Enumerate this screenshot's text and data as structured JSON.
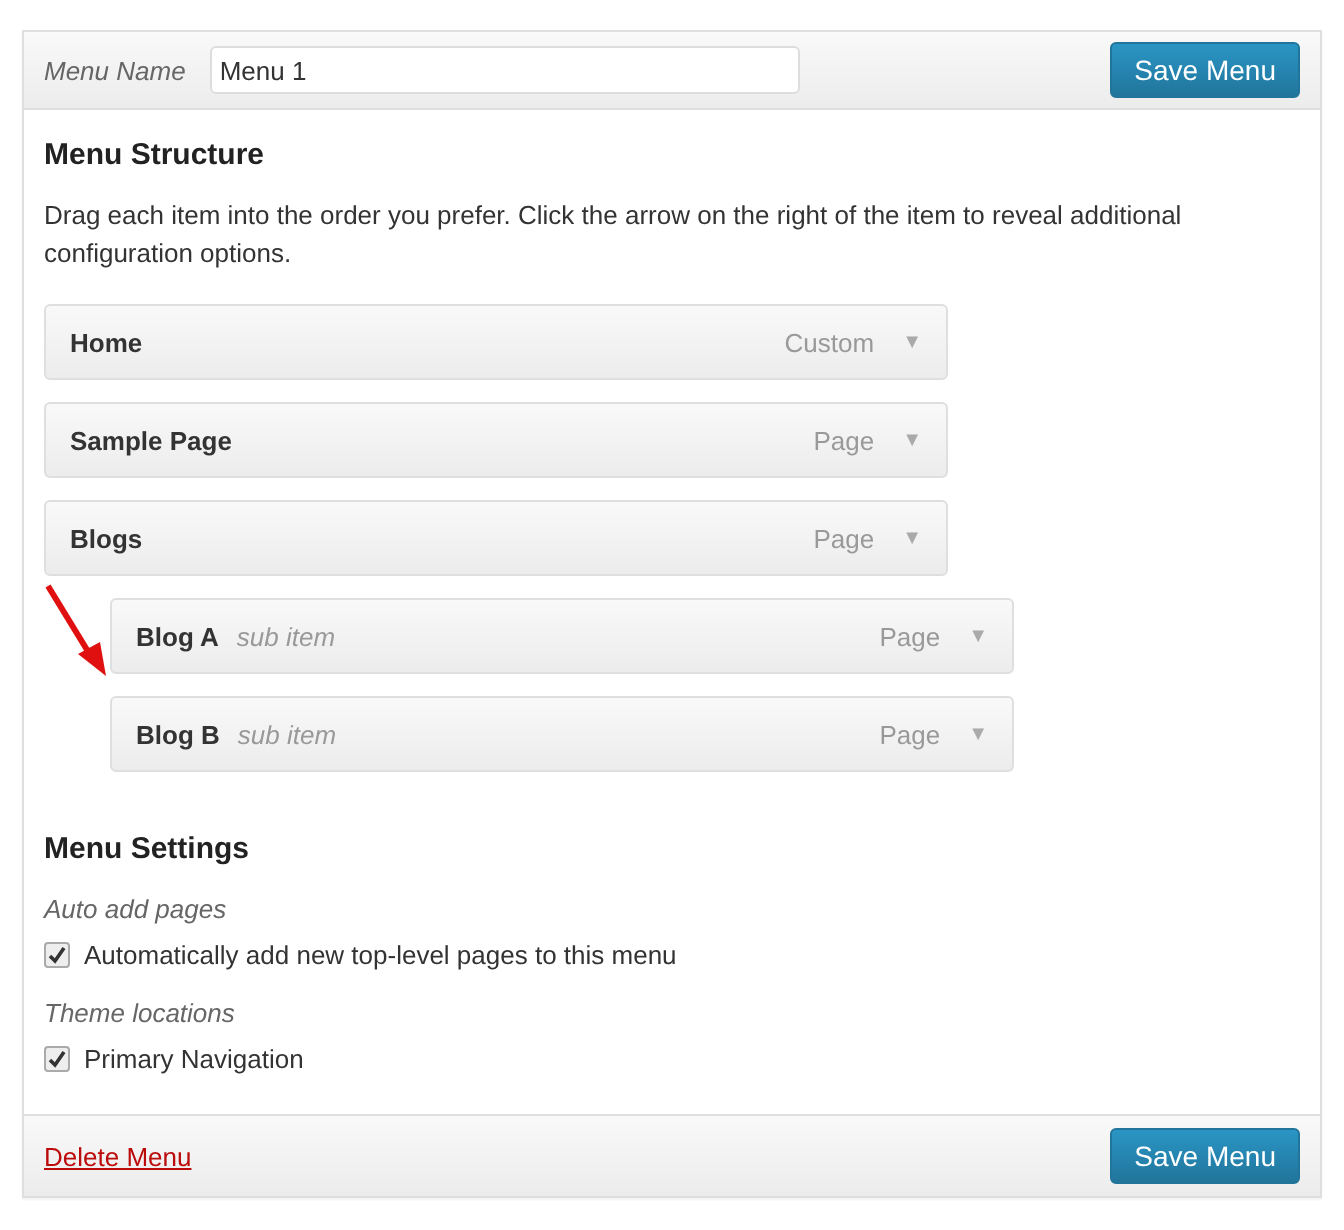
{
  "header": {
    "name_label": "Menu Name",
    "name_value": "Menu 1",
    "save_button": "Save Menu"
  },
  "structure": {
    "title": "Menu Structure",
    "description": "Drag each item into the order you prefer. Click the arrow on the right of the item to reveal additional configuration options.",
    "items": [
      {
        "title": "Home",
        "type": "Custom",
        "arrow": "▼"
      },
      {
        "title": "Sample Page",
        "type": "Page",
        "arrow": "▼"
      },
      {
        "title": "Blogs",
        "type": "Page",
        "arrow": "▼",
        "children": [
          {
            "title": "Blog A",
            "note": "sub item",
            "type": "Page",
            "arrow": "▼"
          },
          {
            "title": "Blog B",
            "note": "sub item",
            "type": "Page",
            "arrow": "▼"
          }
        ]
      }
    ]
  },
  "settings": {
    "title": "Menu Settings",
    "groups": [
      {
        "label": "Auto add pages",
        "options": [
          {
            "text": "Automatically add new top-level pages to this menu",
            "checked": true
          }
        ]
      },
      {
        "label": "Theme locations",
        "options": [
          {
            "text": "Primary Navigation",
            "checked": true
          }
        ]
      }
    ]
  },
  "footer": {
    "delete_link": "Delete Menu",
    "save_button": "Save Menu"
  }
}
